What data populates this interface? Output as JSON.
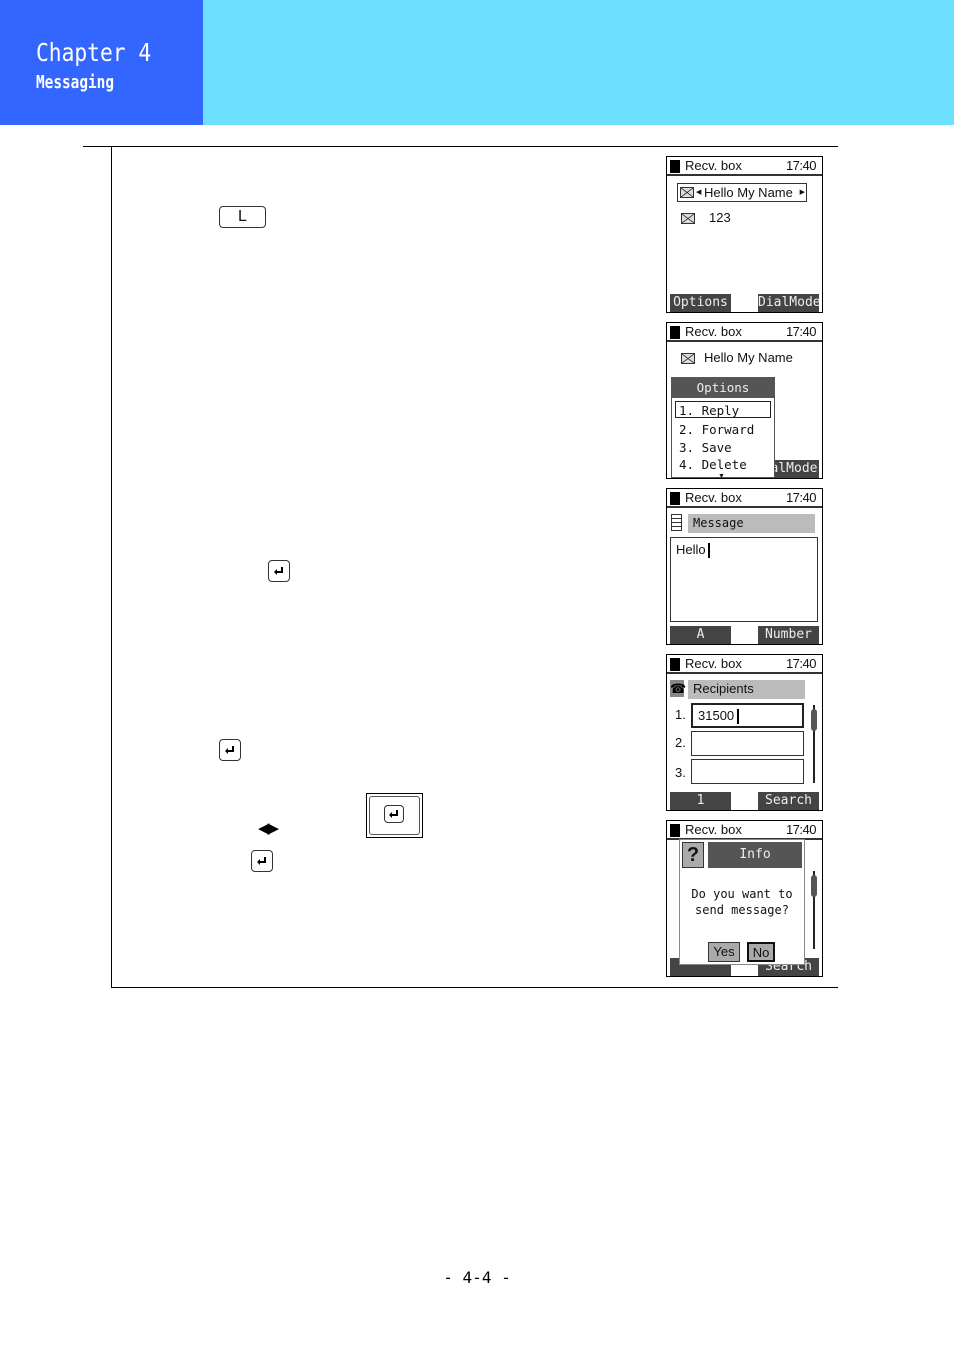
{
  "header": {
    "chapter": "Chapter 4",
    "section": "Messaging",
    "colors": {
      "left": "#3366ff",
      "right": "#6ddfff"
    }
  },
  "keys": {
    "l_key": "L",
    "enter_icon": "enter-key-icon",
    "arrows": "◀▶"
  },
  "screens": [
    {
      "status_title": "Recv. box",
      "time": "17:40",
      "subject": "Hello My Name",
      "sender": "123",
      "softkey_left": "Options",
      "softkey_right": "DialMode"
    },
    {
      "status_title": "Recv. box",
      "time": "17:40",
      "subject": "Hello My Name",
      "menu_title": "Options",
      "menu_items": [
        "1. Reply",
        "2. Forward",
        "3. Save",
        "4. Delete"
      ],
      "softkey_right": "alMode"
    },
    {
      "status_title": "Recv. box",
      "time": "17:40",
      "field_label": "Message",
      "text_value": "Hello",
      "softkey_left": "A",
      "softkey_right": "Number"
    },
    {
      "status_title": "Recv. box",
      "time": "17:40",
      "field_label": "Recipients",
      "rows": [
        {
          "num": "1.",
          "value": "31500"
        },
        {
          "num": "2.",
          "value": ""
        },
        {
          "num": "3.",
          "value": ""
        }
      ],
      "softkey_left": "1",
      "softkey_right": "Search"
    },
    {
      "status_title": "Recv. box",
      "time": "17:40",
      "dialog_title": "Info",
      "dialog_icon": "?",
      "dialog_line1": "Do you want to",
      "dialog_line2": "send message?",
      "yes": "Yes",
      "no": "No",
      "softkey_right": "Search"
    }
  ],
  "footer": {
    "page_number": "- 4-4 -"
  }
}
